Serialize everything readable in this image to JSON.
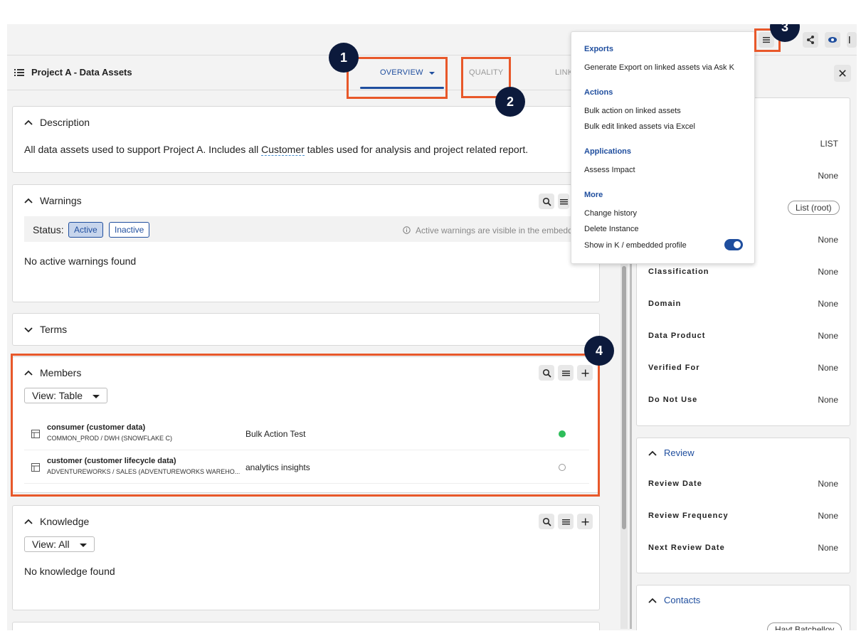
{
  "header": {
    "title": "Project A - Data Assets",
    "tabs": [
      {
        "label": "OVERVIEW"
      },
      {
        "label": "QUALITY"
      },
      {
        "label": "LINK"
      }
    ]
  },
  "description": {
    "title": "Description",
    "text_before": "All data assets used to support Project A. Includes all ",
    "term": "Customer",
    "text_after": " tables used for analysis and project related report."
  },
  "warnings": {
    "title": "Warnings",
    "status_label": "Status:",
    "active_label": "Active",
    "inactive_label": "Inactive",
    "note": "Active warnings are visible in the embeddi",
    "empty": "No active warnings found"
  },
  "terms": {
    "title": "Terms"
  },
  "members": {
    "title": "Members",
    "view": "View: Table",
    "rows": [
      {
        "name": "consumer (customer data)",
        "path": "COMMON_PROD / DWH (SNOWFLAKE C)",
        "description": "Bulk Action Test",
        "status_color": "#2ebd5a"
      },
      {
        "name": "customer (customer lifecycle data)",
        "path": "ADVENTUREWORKS / SALES (ADVENTUREWORKS WAREHO...",
        "description": "analytics insights",
        "status_color": "#ffffff"
      }
    ]
  },
  "knowledge": {
    "title": "Knowledge",
    "view": "View: All",
    "empty": "No knowledge found"
  },
  "properties": {
    "type_value": "LIST",
    "value2": "None",
    "chip": "List (root)",
    "value4": "None",
    "rows": [
      {
        "label": "Classification",
        "value": "None"
      },
      {
        "label": "Domain",
        "value": "None"
      },
      {
        "label": "Data Product",
        "value": "None"
      },
      {
        "label": "Verified For",
        "value": "None"
      },
      {
        "label": "Do Not Use",
        "value": "None"
      }
    ]
  },
  "review": {
    "title": "Review",
    "rows": [
      {
        "label": "Review Date",
        "value": "None"
      },
      {
        "label": "Review Frequency",
        "value": "None"
      },
      {
        "label": "Next Review Date",
        "value": "None"
      }
    ]
  },
  "contacts": {
    "title": "Contacts",
    "chip": "Hayt Batchelloy"
  },
  "menu": {
    "exports_head": "Exports",
    "export_item": "Generate Export on linked assets via Ask K",
    "actions_head": "Actions",
    "bulk_action": "Bulk action on linked assets",
    "bulk_edit": "Bulk edit linked assets via Excel",
    "applications_head": "Applications",
    "assess_impact": "Assess Impact",
    "more_head": "More",
    "change_history": "Change history",
    "delete_instance": "Delete Instance",
    "show_in_k": "Show in K / embedded profile"
  },
  "badges": [
    "1",
    "2",
    "3",
    "4"
  ],
  "colors": {
    "accent": "#1f4e9e",
    "highlight": "#e8582a",
    "badge": "#0c1a3c"
  }
}
